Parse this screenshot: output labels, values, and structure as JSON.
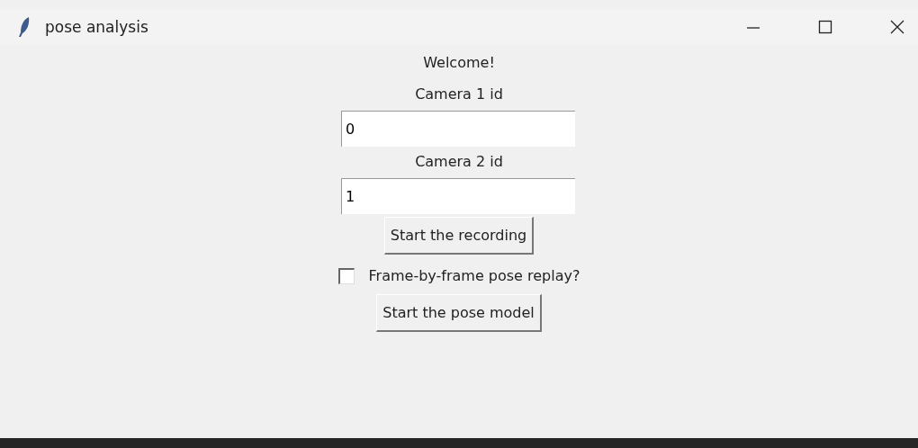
{
  "window": {
    "title": "pose analysis"
  },
  "content": [
    {
      "kind": "label",
      "text": "Welcome!"
    },
    {
      "kind": "label",
      "text": "Camera 1 id"
    },
    {
      "kind": "entry",
      "value": "0"
    },
    {
      "kind": "label",
      "text": "Camera 2 id"
    },
    {
      "kind": "entry",
      "value": "1"
    },
    {
      "kind": "button",
      "text": "Start the recording"
    },
    {
      "kind": "checkbox",
      "text": "Frame-by-frame pose replay?",
      "checked": false
    },
    {
      "kind": "button",
      "text": "Start the pose model"
    }
  ]
}
